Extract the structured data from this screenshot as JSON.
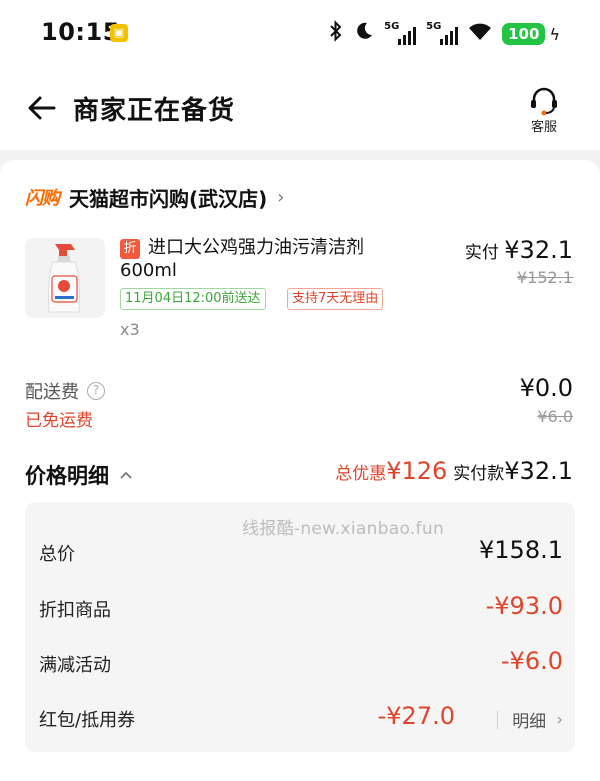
{
  "status_bar": {
    "time": "10:15",
    "app_icon": "⬚",
    "network_1": "5G",
    "network_2": "5G",
    "battery": "100"
  },
  "header": {
    "title": "商家正在备货",
    "service_label": "客服"
  },
  "store": {
    "logo_text": "闪购",
    "name": "天猫超市闪购(武汉店)",
    "chevron": "›"
  },
  "product": {
    "discount_tag": "折",
    "title_line1": "进口大公鸡强力油污清洁剂",
    "title_line2": "600ml",
    "delivery_tag": "11月04日12:00前送达",
    "return_tag": "支持7天无理由",
    "quantity": "x3",
    "paid_label": "实付",
    "paid_price": "¥32.1",
    "original_price": "¥152.1"
  },
  "shipping": {
    "label": "配送费",
    "help": "?",
    "free_text": "已免运费",
    "price": "¥0.0",
    "original": "¥6.0"
  },
  "price_detail": {
    "title": "价格明细",
    "discount_label": "总优惠",
    "discount_amount": "¥126",
    "paid_label": "实付款",
    "paid_amount": "¥32.1",
    "rows": [
      {
        "label": "总价",
        "value": "¥158.1"
      },
      {
        "label": "折扣商品",
        "value": "-¥93.0"
      },
      {
        "label": "满减活动",
        "value": "-¥6.0"
      },
      {
        "label": "红包/抵用券",
        "value": "-¥27.0",
        "more": "明细"
      }
    ]
  },
  "watermark": "线报酷-new.xianbao.fun",
  "colors": {
    "accent_red": "#e0452b",
    "green": "#3aa63a",
    "brand_orange": "#ff6a00",
    "battery_green": "#23c343"
  }
}
